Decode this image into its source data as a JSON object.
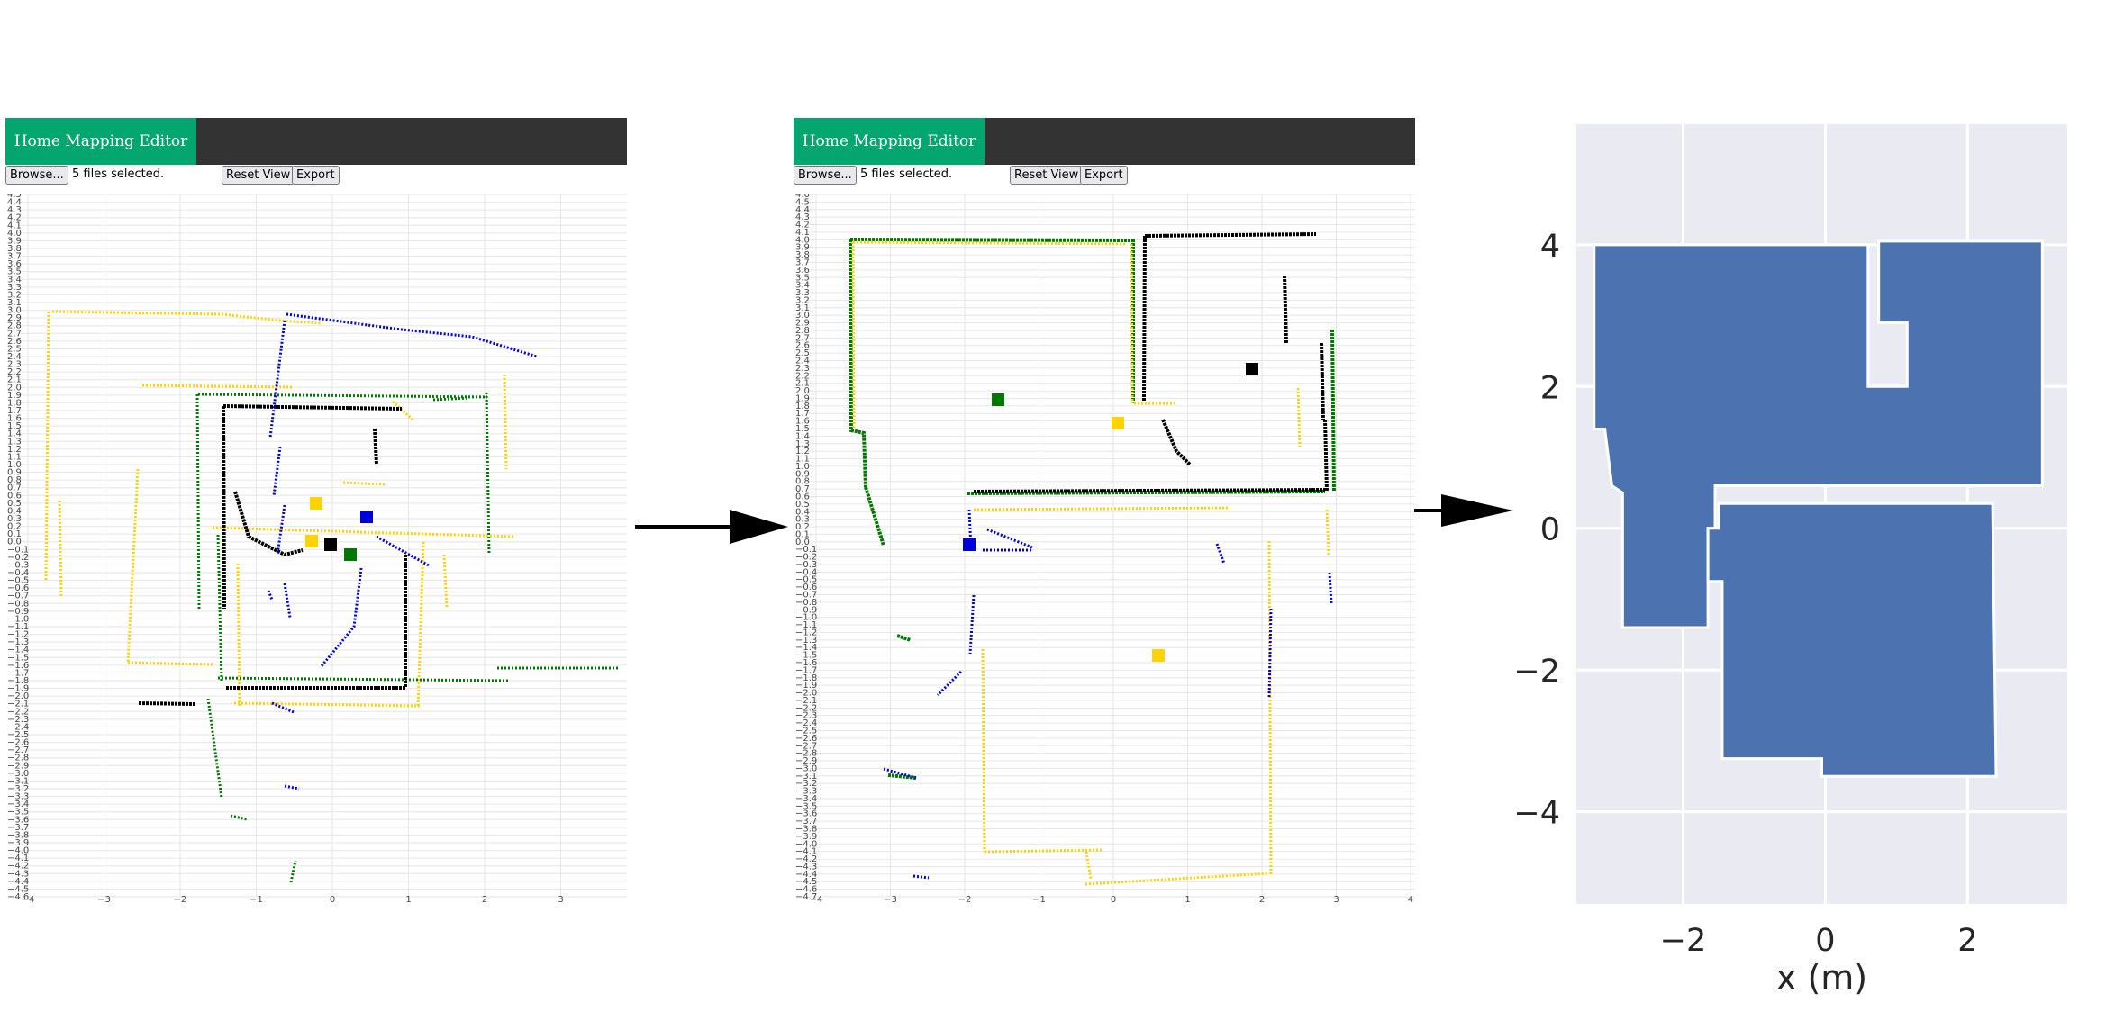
{
  "editors": [
    {
      "id": "left",
      "app_title": "Home Mapping Editor",
      "browse_label": "Browse...",
      "files_status": "5 files selected.",
      "reset_label": "Reset View",
      "export_label": "Export",
      "x_ticks": [
        "−4",
        "−3",
        "−2",
        "−1",
        "0",
        "1",
        "2",
        "3"
      ],
      "y_range": [
        -4.6,
        4.5
      ]
    },
    {
      "id": "right",
      "app_title": "Home Mapping Editor",
      "browse_label": "Browse...",
      "files_status": "5 files selected.",
      "reset_label": "Reset View",
      "export_label": "Export",
      "x_ticks": [
        "−4",
        "−3",
        "−2",
        "−1",
        "0",
        "1",
        "2",
        "3",
        "4"
      ],
      "y_range": [
        -4.7,
        4.6
      ]
    }
  ],
  "colors": {
    "accent": "#04a66f",
    "titlebar": "#333333",
    "scan_blue": "#0000dd",
    "scan_yellow": "#ffd200",
    "scan_green": "#007700",
    "scan_black": "#000000",
    "floor_fill": "#4c72b0",
    "plot_bg": "#eaeaf2"
  },
  "chart_data": {
    "type": "area",
    "title": "",
    "xlabel": "x (m)",
    "ylabel": "",
    "xlim": [
      -3.5,
      3.4
    ],
    "ylim": [
      -5.3,
      5.7
    ],
    "x_ticks": [
      -2,
      0,
      2
    ],
    "x_tick_labels": [
      "−2",
      "0",
      "2"
    ],
    "y_ticks": [
      -4,
      -2,
      0,
      2,
      4
    ],
    "y_tick_labels": [
      "−4",
      "−2",
      "0",
      "2",
      "4"
    ],
    "grid": true,
    "polygons": [
      [
        [
          -3.25,
          4.0
        ],
        [
          0.6,
          4.0
        ],
        [
          0.6,
          2.0
        ],
        [
          1.15,
          2.0
        ],
        [
          1.15,
          2.9
        ],
        [
          0.75,
          2.9
        ],
        [
          0.75,
          4.05
        ],
        [
          3.05,
          4.05
        ],
        [
          3.05,
          0.6
        ],
        [
          -1.55,
          0.6
        ],
        [
          -1.55,
          0.0
        ],
        [
          -1.65,
          0.0
        ],
        [
          -1.65,
          -1.4
        ],
        [
          -2.85,
          -1.4
        ],
        [
          -2.85,
          0.5
        ],
        [
          -3.0,
          0.6
        ],
        [
          -3.1,
          1.4
        ],
        [
          -3.25,
          1.4
        ]
      ],
      [
        [
          -1.5,
          0.35
        ],
        [
          2.35,
          0.35
        ],
        [
          2.4,
          -3.5
        ],
        [
          -0.05,
          -3.5
        ],
        [
          -0.05,
          -3.25
        ],
        [
          -1.45,
          -3.25
        ],
        [
          -1.45,
          -0.75
        ],
        [
          -1.65,
          -0.75
        ],
        [
          -1.65,
          0.0
        ],
        [
          -1.5,
          0.0
        ]
      ]
    ]
  }
}
